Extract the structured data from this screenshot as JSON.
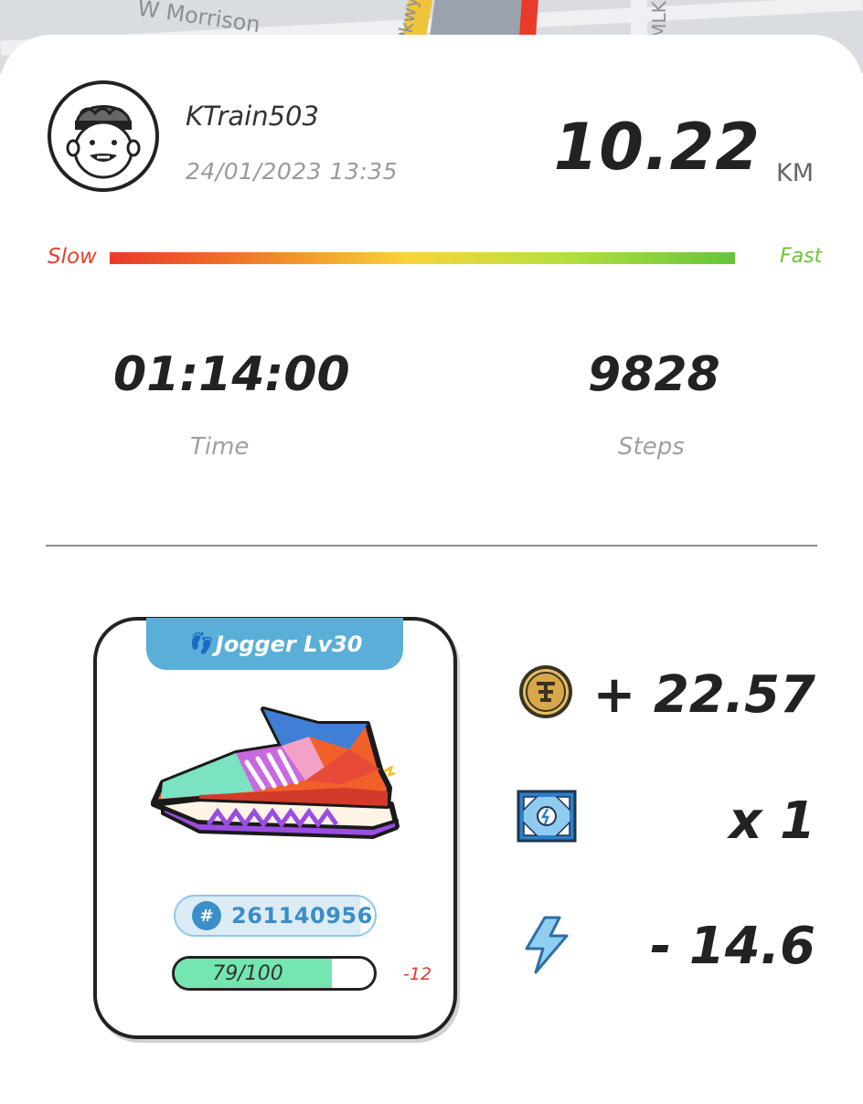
{
  "map": {
    "street_labels": [
      "W Morrison",
      "Pkwy",
      "MLK"
    ]
  },
  "profile": {
    "username": "KTrain503",
    "datetime": "24/01/2023 13:35"
  },
  "distance": {
    "value": "10.22",
    "unit": "KM"
  },
  "speed_scale": {
    "slow_label": "Slow",
    "fast_label": "Fast"
  },
  "stats": {
    "time_value": "01:14:00",
    "time_label": "Time",
    "steps_value": "9828",
    "steps_label": "Steps"
  },
  "sneaker": {
    "type_level": "Jogger Lv30",
    "id_number": "261140956",
    "durability_text": "79/100",
    "durability_fraction": 0.79,
    "durability_change": "-12"
  },
  "rewards": {
    "gst_value": "+ 22.57",
    "box_value": "x 1",
    "energy_value": "- 14.6"
  },
  "colors": {
    "tab_blue": "#5aaed8",
    "slow_red": "#e8402a",
    "fast_green": "#6cc437",
    "durability_fill": "#74e6b0"
  },
  "icons": [
    "gst-coin-icon",
    "mystery-box-icon",
    "energy-bolt-icon",
    "hash-icon",
    "footprint-icon"
  ]
}
